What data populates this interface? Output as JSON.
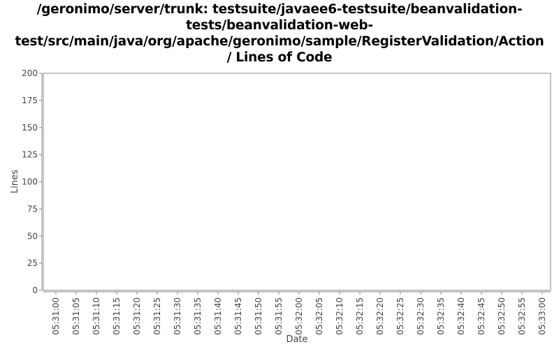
{
  "chart_data": {
    "type": "line",
    "title_lines": [
      "/geronimo/server/trunk: testsuite/javaee6-testsuite/beanvalidation-",
      "tests/beanvalidation-web-",
      "test/src/main/java/org/apache/geronimo/sample/RegisterValidation/Action",
      "/ Lines of Code"
    ],
    "xlabel": "Date",
    "ylabel": "Lines",
    "ylim": [
      0,
      200
    ],
    "y_ticks": [
      0,
      25,
      50,
      75,
      100,
      125,
      150,
      175,
      200
    ],
    "x_ticks": [
      "05:31:00",
      "05:31:05",
      "05:31:10",
      "05:31:15",
      "05:31:20",
      "05:31:25",
      "05:31:30",
      "05:31:35",
      "05:31:40",
      "05:31:45",
      "05:31:50",
      "05:31:55",
      "05:32:00",
      "05:32:05",
      "05:32:10",
      "05:32:15",
      "05:32:20",
      "05:32:25",
      "05:32:30",
      "05:32:35",
      "05:32:40",
      "05:32:45",
      "05:32:50",
      "05:32:55",
      "05:33:00"
    ],
    "series": [
      {
        "values": []
      }
    ],
    "grid": false,
    "colors": {
      "plot_border": "#888888",
      "axis_line": "#888888",
      "tick_text": "#444444",
      "plot_background": "#ffffff"
    }
  }
}
